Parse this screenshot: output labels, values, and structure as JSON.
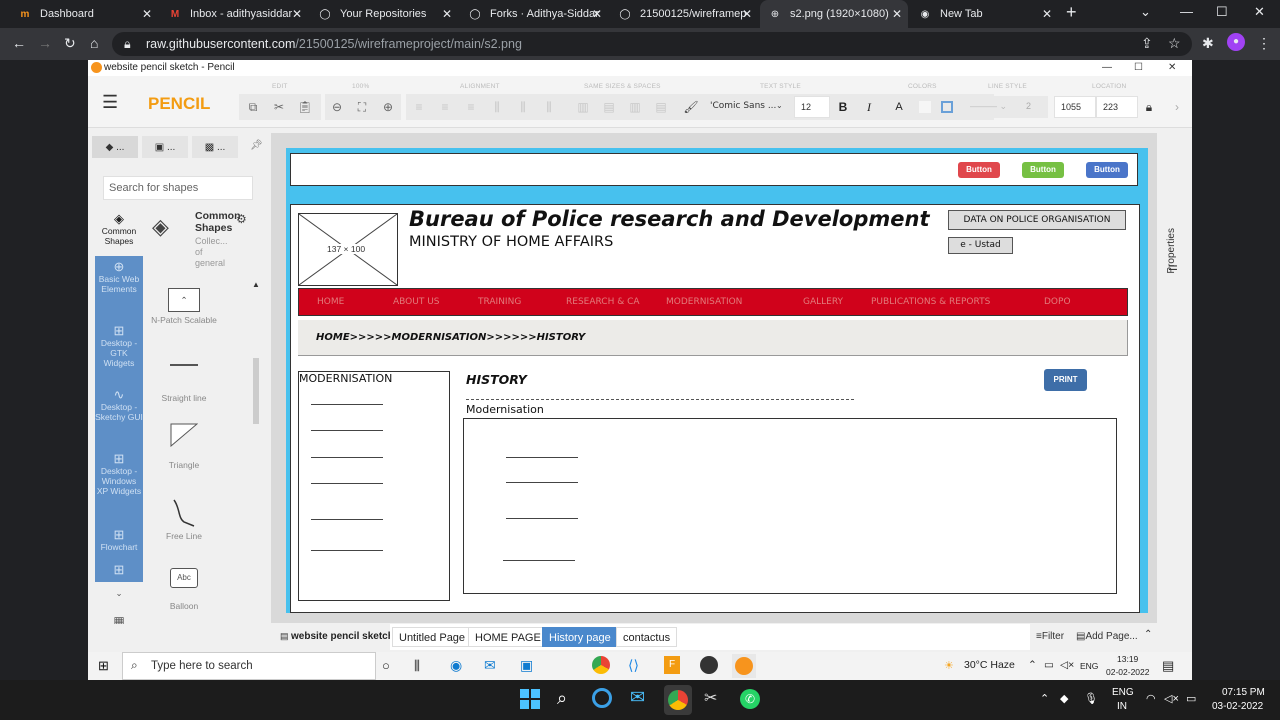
{
  "browser": {
    "tabs": [
      {
        "title": "Dashboard",
        "icon": "m-logo-icon"
      },
      {
        "title": "Inbox - adithyasiddar",
        "icon": "gmail-icon"
      },
      {
        "title": "Your Repositories",
        "icon": "github-icon"
      },
      {
        "title": "Forks · Adithya-Siddar",
        "icon": "github-icon"
      },
      {
        "title": "21500125/wireframep",
        "icon": "github-icon"
      },
      {
        "title": "s2.png (1920×1080)",
        "icon": "globe-icon",
        "active": true
      },
      {
        "title": "New Tab",
        "icon": "chrome-icon"
      }
    ],
    "new_tab": "+",
    "url_host": "raw.githubusercontent.com",
    "url_path": "/21500125/wireframeproject/main/s2.png"
  },
  "pencil": {
    "window_title": "website pencil sketch - Pencil",
    "app_name": "PENCIL",
    "toolbar": {
      "groups": [
        "EDIT",
        "100%",
        "ALIGNMENT",
        "SAME SIZES & SPACES",
        "TEXT STYLE",
        "COLORS",
        "LINE STYLE",
        "LOCATION"
      ],
      "font": "'Comic Sans ...",
      "font_size": "12",
      "line_width": "2",
      "x": "1055",
      "y": "223"
    },
    "left": {
      "tabs": [
        "...",
        "...",
        "..."
      ],
      "search_placeholder": "Search for shapes",
      "collections": [
        "Common Shapes",
        "Basic Web Elements",
        "Desktop - GTK Widgets",
        "Desktop - Sketchy GUI",
        "Desktop - Windows XP Widgets",
        "Flowchart"
      ],
      "collection_title": "Common Shapes",
      "collection_desc": "Collec... of general shapes",
      "shapes": [
        "N-Patch Scalable",
        "Straight line",
        "Triangle",
        "Free Line",
        "Balloon"
      ],
      "balloon_text": "Abc"
    },
    "right_panel": "Properties",
    "bottom": {
      "doc": "website pencil sketch",
      "pages": [
        "Untitled Page",
        "HOME PAGE",
        "History page",
        "contactus"
      ],
      "filter": "Filter",
      "add_page": "Add Page..."
    }
  },
  "wireframe": {
    "top_buttons": [
      "Button",
      "Button",
      "Button"
    ],
    "image_placeholder": "137 × 100",
    "title": "Bureau of Police research and Development",
    "subtitle": "MINISTRY OF HOME AFFAIRS",
    "side_buttons": [
      "DATA ON POLICE ORGANISATION",
      "e - Ustad"
    ],
    "nav": [
      "HOME",
      "ABOUT US",
      "TRAINING",
      "RESEARCH & CA",
      "MODERNISATION",
      "GALLERY",
      "PUBLICATIONS & REPORTS",
      "DOPO"
    ],
    "breadcrumb": "HOME>>>>>MODERNISATION>>>>>>HISTORY",
    "sidebar_title": "MODERNISATION",
    "page_heading": "HISTORY",
    "print_button": "PRINT",
    "section_label": "Modernisation"
  },
  "os": {
    "search": "Type here to search",
    "weather": "30°C  Haze",
    "lang": "ENG",
    "time_small": "13:19",
    "date_small": "02-02-2022",
    "lang2": "ENG",
    "region": "IN",
    "time": "07:15 PM",
    "date": "03-02-2022"
  }
}
